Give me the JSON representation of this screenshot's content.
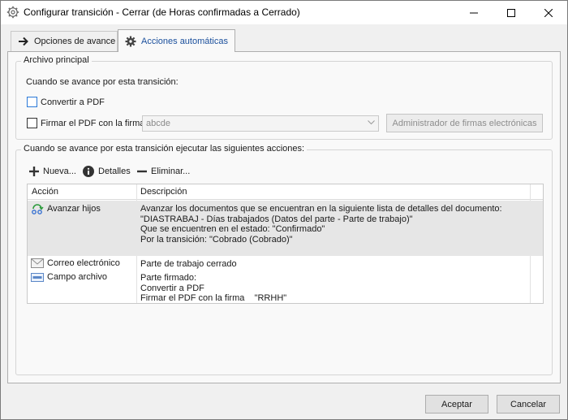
{
  "window": {
    "title": "Configurar transición - Cerrar (de Horas confirmadas a Cerrado)"
  },
  "tabs": [
    {
      "label": "Opciones de avance",
      "icon": "arrow-right-icon",
      "active": false
    },
    {
      "label": "Acciones automáticas",
      "icon": "gear-icon",
      "active": true
    }
  ],
  "main_file": {
    "legend": "Archivo principal",
    "heading": "Cuando se avance por esta transición:",
    "convert_pdf_label": "Convertir a PDF",
    "convert_pdf_checked": false,
    "sign_pdf_label": "Firmar el PDF con la firma",
    "sign_pdf_checked": false,
    "signature_value": "abcde",
    "signature_manager_label": "Administrador de firmas electrónicas"
  },
  "actions": {
    "legend": "Cuando se avance por esta transición ejecutar las siguientes acciones:",
    "toolbar": {
      "new_label": "Nueva...",
      "details_label": "Detalles",
      "delete_label": "Eliminar..."
    },
    "columns": [
      "Acción",
      "Descripción"
    ],
    "rows": [
      {
        "action": "Avanzar hijos",
        "icon": "advance-children-icon",
        "selected": true,
        "desc": [
          "Avanzar los documentos que se encuentran en la siguiente lista de detalles del documento:",
          "\"DIASTRABAJ - Días trabajados (Datos del parte - Parte de trabajo)\"",
          "Que se encuentren en el estado: \"Confirmado\"",
          "Por la transición: \"Cobrado (Cobrado)\""
        ]
      },
      {
        "action": "Correo electrónico",
        "icon": "envelope-icon",
        "selected": false,
        "desc": [
          "Parte de trabajo cerrado"
        ]
      },
      {
        "action": "Campo archivo",
        "icon": "file-field-icon",
        "selected": false,
        "desc": [
          "Parte firmado:",
          "Convertir a PDF",
          "Firmar el PDF con la firma    \"RRHH\""
        ]
      }
    ]
  },
  "buttons": {
    "accept_label": "Aceptar",
    "cancel_label": "Cancelar"
  },
  "colors": {
    "accent": "#1a4f9c",
    "selection": "#e6e6e6",
    "focus_border": "#2b79d8"
  }
}
